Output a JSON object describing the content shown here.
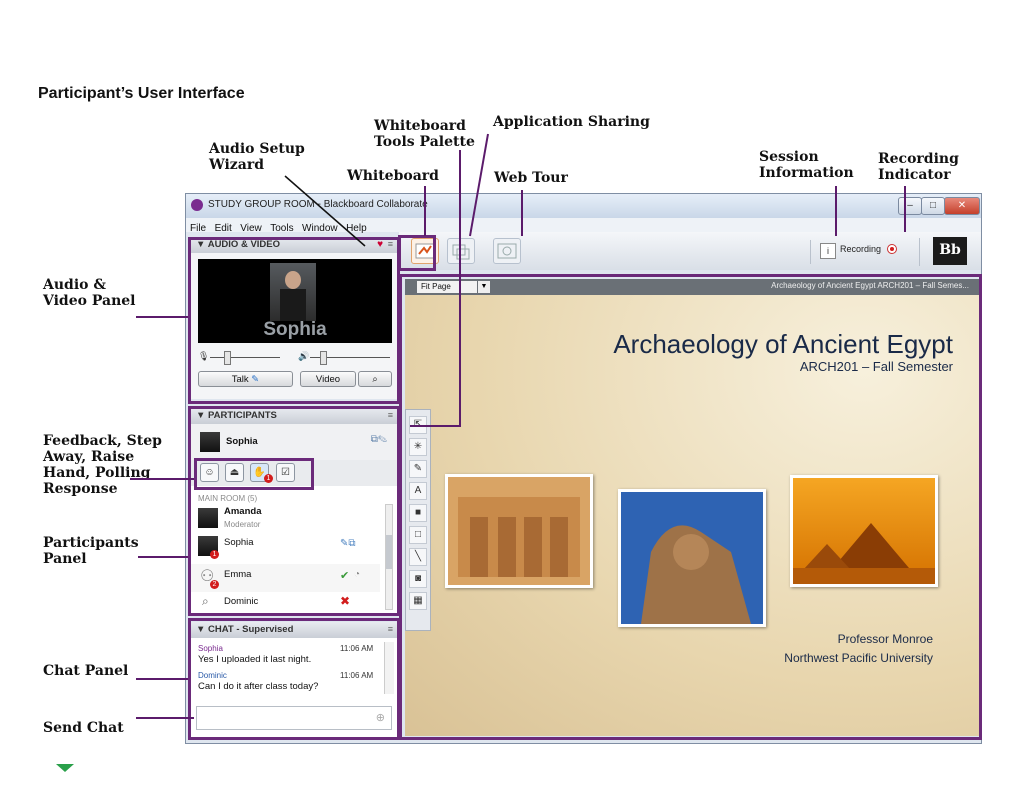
{
  "document": {
    "title": "Participant’s User Interface"
  },
  "callouts": {
    "audio_setup": "Audio Setup\nWizard",
    "whiteboard_tools": "Whiteboard\nTools Palette",
    "app_sharing": "Application Sharing",
    "whiteboard": "Whiteboard",
    "web_tour": "Web Tour",
    "session_info": "Session\nInformation",
    "recording_indicator": "Recording\nIndicator",
    "av_panel": "Audio &\nVideo Panel",
    "feedback": "Feedback, Step\nAway, Raise\nHand, Polling\nResponse",
    "participants_panel": "Participants\nPanel",
    "chat_panel": "Chat Panel",
    "send_chat": "Send Chat"
  },
  "window": {
    "title": "STUDY GROUP ROOM - Blackboard Collaborate",
    "menu": [
      "File",
      "Edit",
      "View",
      "Tools",
      "Window",
      "Help"
    ],
    "recording_label": "Recording",
    "logo": "Bb"
  },
  "audio_video": {
    "header": "AUDIO & VIDEO",
    "speaker_name": "Sophia",
    "talk_label": "Talk",
    "video_label": "Video"
  },
  "participants": {
    "header": "PARTICIPANTS",
    "me": "Sophia",
    "room_label": "MAIN ROOM (5)",
    "list": [
      {
        "name": "Amanda",
        "role": "Moderator"
      },
      {
        "name": "Sophia",
        "badge": "1"
      },
      {
        "name": "Emma",
        "badge": "2"
      },
      {
        "name": "Dominic"
      }
    ],
    "feedback_badge": "1"
  },
  "chat": {
    "header": "CHAT - Supervised",
    "messages": [
      {
        "sender": "Sophia",
        "time": "11:06 AM",
        "text": "Yes I uploaded it last night."
      },
      {
        "sender": "Dominic",
        "time": "11:06 AM",
        "text": "Can I do it after class today?"
      }
    ]
  },
  "whiteboard": {
    "fit_label": "Fit Page",
    "caption": "Archaeology of Ancient Egypt ARCH201 – Fall Semes...",
    "title": "Archaeology of Ancient Egypt",
    "subtitle": "ARCH201 – Fall Semester",
    "professor": "Professor Monroe",
    "university": "Northwest Pacific University"
  }
}
